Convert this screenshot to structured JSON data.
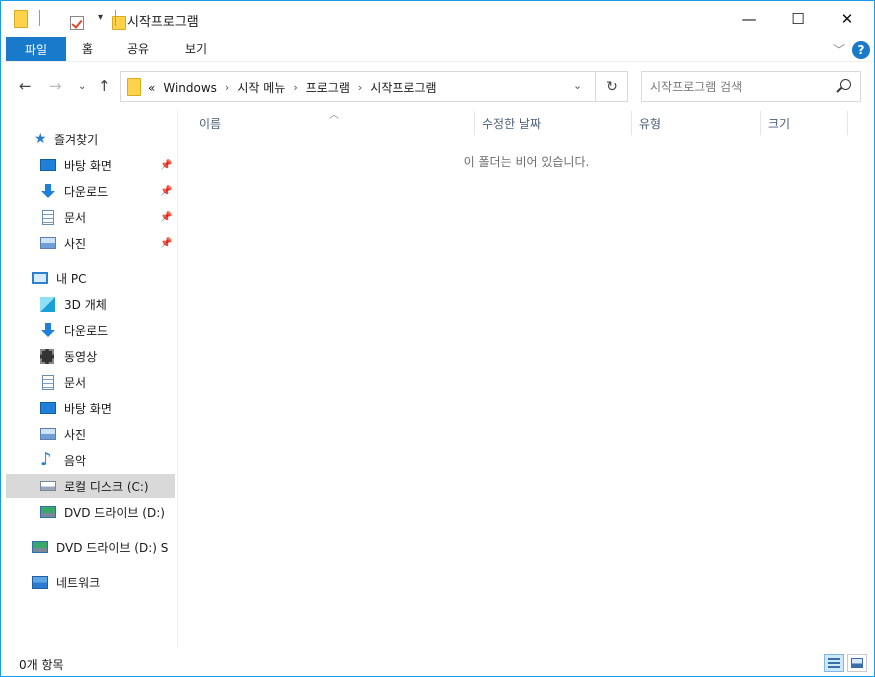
{
  "window": {
    "title": "시작프로그램",
    "controls": {
      "minimize": "—",
      "maximize": "☐",
      "close": "✕"
    }
  },
  "ribbon": {
    "file_tab": "파일",
    "tabs": [
      "홈",
      "공유",
      "보기"
    ]
  },
  "address": {
    "overflow": "«",
    "crumbs": [
      "Windows",
      "시작 메뉴",
      "프로그램",
      "시작프로그램"
    ],
    "separator": "›"
  },
  "search": {
    "placeholder": "시작프로그램 검색"
  },
  "nav": {
    "quick_access": {
      "label": "즐겨찾기",
      "items": [
        {
          "label": "바탕 화면",
          "icon": "desktop-icon",
          "pinned": true
        },
        {
          "label": "다운로드",
          "icon": "download-icon",
          "pinned": true
        },
        {
          "label": "문서",
          "icon": "document-icon",
          "pinned": true
        },
        {
          "label": "사진",
          "icon": "pictures-icon",
          "pinned": true
        }
      ]
    },
    "this_pc": {
      "label": "내 PC",
      "items": [
        {
          "label": "3D 개체",
          "icon": "3d-objects-icon"
        },
        {
          "label": "다운로드",
          "icon": "download-icon"
        },
        {
          "label": "동영상",
          "icon": "video-icon"
        },
        {
          "label": "문서",
          "icon": "document-icon"
        },
        {
          "label": "바탕 화면",
          "icon": "desktop-icon"
        },
        {
          "label": "사진",
          "icon": "pictures-icon"
        },
        {
          "label": "음악",
          "icon": "music-icon"
        },
        {
          "label": "로컬 디스크 (C:)",
          "icon": "local-disk-icon",
          "selected": true
        },
        {
          "label": "DVD 드라이브 (D:)",
          "icon": "dvd-drive-icon"
        }
      ]
    },
    "dvd_root": {
      "label": "DVD 드라이브 (D:) S"
    },
    "network": {
      "label": "네트워크"
    }
  },
  "columns": [
    "이름",
    "수정한 날짜",
    "유형",
    "크기"
  ],
  "empty_message": "이 폴더는 비어 있습니다.",
  "status": {
    "item_count": "0개 항목"
  }
}
